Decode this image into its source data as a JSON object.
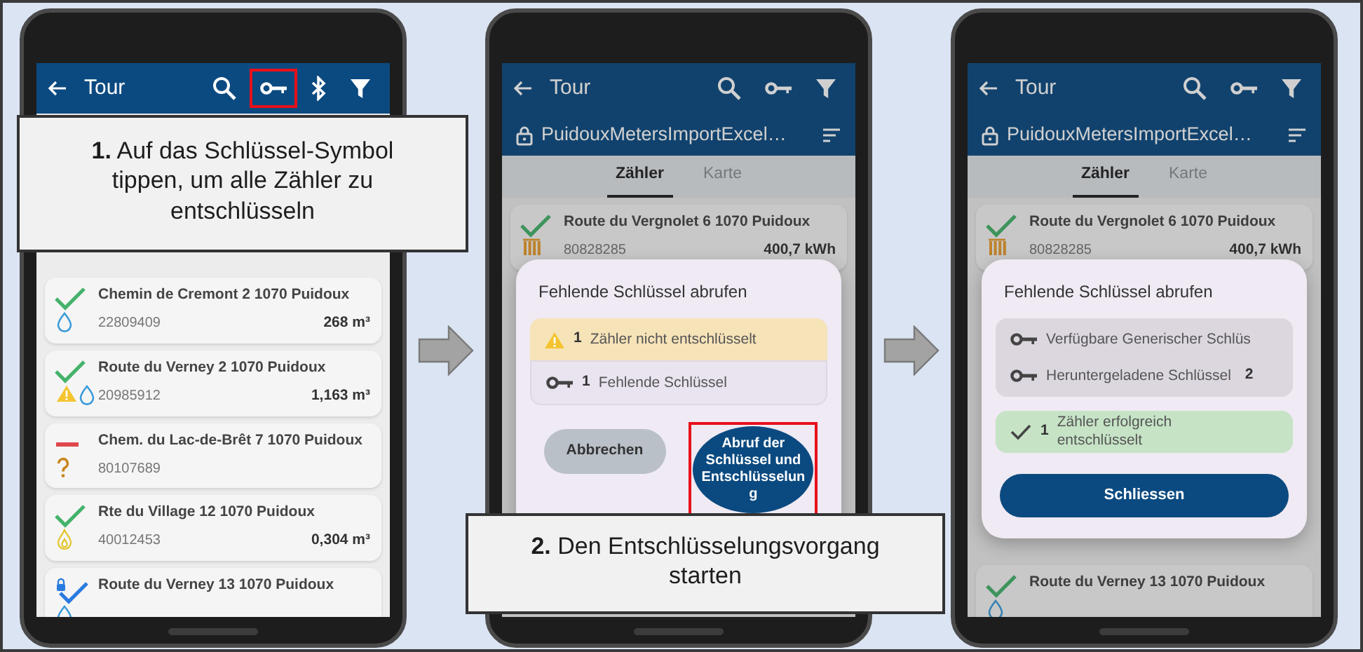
{
  "screens": [
    {
      "appbar": {
        "title": "Tour",
        "actions": [
          {
            "kind": "search",
            "highlighted": false
          },
          {
            "kind": "key",
            "highlighted": true
          },
          {
            "kind": "bluetooth",
            "highlighted": false
          },
          {
            "kind": "filter",
            "highlighted": false
          }
        ]
      },
      "cards_top": [
        {
          "address": "Chemin de Cremont 2 1070 Puidoux",
          "number": "22809409",
          "reading": "268 m³",
          "kind": "ok",
          "icons": [
            {
              "kind": "water"
            }
          ]
        },
        {
          "address": "Route du Verney 2 1070 Puidoux",
          "number": "20985912",
          "reading": "1,163 m³",
          "kind": "ok",
          "icons": [
            {
              "kind": "warning"
            },
            {
              "kind": "water"
            }
          ]
        },
        {
          "address": "Chem. du Lac-de-Brêt 7 1070 Puidoux",
          "number": "80107689",
          "kind": "failed",
          "icons": [
            {
              "kind": "unknown"
            }
          ]
        },
        {
          "address": "Rte du Village 12 1070 Puidoux",
          "number": "40012453",
          "reading": "0,304 m³",
          "kind": "ok",
          "icons": [
            {
              "kind": "gas"
            }
          ]
        },
        {
          "address": "Route du Verney 13 1070 Puidoux",
          "kind": "locked",
          "icons": [
            {
              "kind": "water"
            }
          ]
        }
      ],
      "callout": {
        "text": "**1.** Auf das Schlüssel-Symbol tippen, um alle Zähler zu entschlüsseln"
      }
    },
    {
      "appbar": {
        "title": "Tour",
        "subtitle": "PuidouxMetersImportExcel…",
        "actions": [
          {
            "kind": "search",
            "highlighted": false
          },
          {
            "kind": "key",
            "highlighted": false
          },
          {
            "kind": "filter",
            "highlighted": false
          }
        ]
      },
      "tabs": [
        {
          "label": "Zähler",
          "selected": true
        },
        {
          "label": "Karte",
          "selected": false
        }
      ],
      "cards_top": [
        {
          "address": "Route du Vergnolet 6 1070 Puidoux",
          "number": "80828285",
          "reading": "400,7 kWh",
          "kind": "ok",
          "icons": [
            {
              "kind": "heat"
            }
          ]
        }
      ],
      "dialog": {
        "title": "Fehlende Schlüssel abrufen",
        "panels": [
          {
            "kind": "warning",
            "rows": [
              {
                "kind": "warning",
                "count": "1",
                "text": "Zähler nicht entschlüsselt"
              }
            ]
          },
          {
            "kind": "plain",
            "rows": [
              {
                "kind": "key",
                "count": "1",
                "text": "Fehlende Schlüssel"
              }
            ]
          }
        ],
        "buttons": [
          {
            "kind": "secondary",
            "label": "Abbrechen",
            "highlighted": false
          },
          {
            "kind": "round",
            "label": "Abruf der Schlüssel und Entschlüsselung",
            "highlighted": true
          }
        ]
      },
      "callout": {
        "text": "**2.** Den Entschlüsselungsvorgang starten"
      }
    },
    {
      "appbar": {
        "title": "Tour",
        "subtitle": "PuidouxMetersImportExcel…",
        "actions": [
          {
            "kind": "search",
            "highlighted": false
          },
          {
            "kind": "key",
            "highlighted": false
          },
          {
            "kind": "filter",
            "highlighted": false
          }
        ]
      },
      "tabs": [
        {
          "label": "Zähler",
          "selected": true
        },
        {
          "label": "Karte",
          "selected": false
        }
      ],
      "cards_top": [
        {
          "address": "Route du Vergnolet 6 1070 Puidoux",
          "number": "80828285",
          "reading": "400,7 kWh",
          "kind": "ok",
          "icons": [
            {
              "kind": "heat"
            }
          ]
        }
      ],
      "cards_bottom": [
        {
          "address": "Route du Verney 13 1070 Puidoux",
          "kind": "ok",
          "icons": [
            {
              "kind": "water"
            }
          ]
        }
      ],
      "dialog": {
        "title": "Fehlende Schlüssel abrufen",
        "panels": [
          {
            "kind": "neutral",
            "rows": [
              {
                "kind": "key",
                "text": "Verfügbare Generischer Schlüs"
              },
              {
                "kind": "key",
                "text": "Heruntergeladene Schlüssel",
                "value": "2"
              }
            ]
          },
          {
            "kind": "success",
            "rows": [
              {
                "kind": "check",
                "count": "1",
                "text": "Zähler erfolgreich entschlüsselt"
              }
            ]
          }
        ],
        "buttons": [
          {
            "kind": "wide",
            "label": "Schliessen",
            "highlighted": false
          }
        ]
      }
    }
  ]
}
